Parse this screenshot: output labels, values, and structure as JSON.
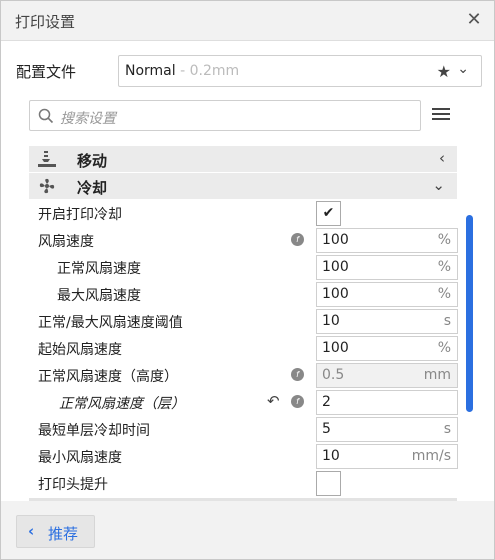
{
  "window": {
    "title": "打印设置"
  },
  "profile": {
    "label": "配置文件",
    "name": "Normal",
    "sub": " - 0.2mm"
  },
  "search": {
    "placeholder": "搜索设置"
  },
  "categories": [
    {
      "label": "移动",
      "arrow": "‹",
      "icon": "travel-icon"
    },
    {
      "label": "冷却",
      "arrow": "⌄",
      "icon": "fan-icon"
    }
  ],
  "settings": [
    {
      "label": "开启打印冷却",
      "type": "checkbox",
      "checked": true
    },
    {
      "label": "风扇速度",
      "value": "100",
      "unit": "%",
      "fx": true
    },
    {
      "label": "正常风扇速度",
      "value": "100",
      "unit": "%"
    },
    {
      "label": "最大风扇速度",
      "value": "100",
      "unit": "%"
    },
    {
      "label": "正常/最大风扇速度阈值",
      "value": "10",
      "unit": "s"
    },
    {
      "label": "起始风扇速度",
      "value": "100",
      "unit": "%"
    },
    {
      "label": "正常风扇速度（高度）",
      "value": "0.5",
      "unit": "mm",
      "fx": true,
      "disabled": true
    },
    {
      "label": "正常风扇速度（层）",
      "value": "2",
      "unit": "",
      "fx": true,
      "reset": true
    },
    {
      "label": "最短单层冷却时间",
      "value": "5",
      "unit": "s"
    },
    {
      "label": "最小风扇速度",
      "value": "10",
      "unit": "mm/s"
    },
    {
      "label": "打印头提升",
      "type": "checkbox",
      "checked": false
    }
  ],
  "footer": {
    "recommend_label": "推荐"
  },
  "colors": {
    "accent": "#2b6fe0",
    "category_bg": "#ebebeb"
  }
}
